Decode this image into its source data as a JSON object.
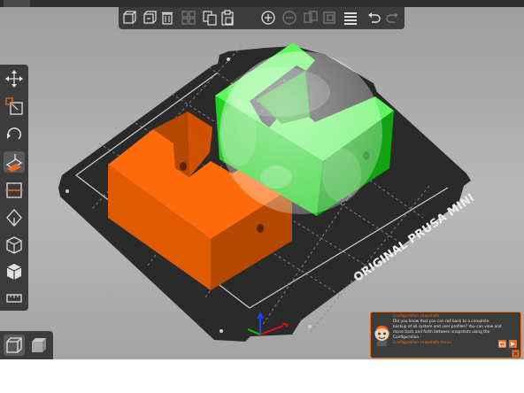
{
  "window": {
    "tabs": [
      {
        "id": "plater",
        "label": "",
        "active": true
      },
      {
        "id": "print-settings",
        "label": "",
        "active": false
      },
      {
        "id": "filament-settings",
        "label": "",
        "active": false
      },
      {
        "id": "printer-settings",
        "label": "",
        "active": false
      }
    ]
  },
  "toolbar": {
    "items": [
      {
        "id": "add",
        "icon": "add-icon",
        "enabled": true
      },
      {
        "id": "delete",
        "icon": "delete-icon",
        "enabled": true
      },
      {
        "id": "delete-all",
        "icon": "delete-all-icon",
        "enabled": true
      },
      {
        "id": "arrange",
        "icon": "arrange-icon",
        "enabled": false
      },
      {
        "id": "copy",
        "icon": "copy-icon",
        "enabled": true
      },
      {
        "id": "paste",
        "icon": "paste-icon",
        "enabled": true
      },
      {
        "id": "add-instance",
        "icon": "add-instance-icon",
        "enabled": true
      },
      {
        "id": "remove-instance",
        "icon": "remove-instance-icon",
        "enabled": false
      },
      {
        "id": "split-objects",
        "icon": "split-objects-icon",
        "enabled": false
      },
      {
        "id": "layer-editing",
        "icon": "layers-icon",
        "enabled": true
      },
      {
        "id": "undo",
        "icon": "undo-icon",
        "enabled": true
      },
      {
        "id": "redo",
        "icon": "redo-icon",
        "enabled": false
      }
    ]
  },
  "gizmos": {
    "items": [
      {
        "id": "move",
        "icon": "move-icon",
        "active": false
      },
      {
        "id": "scale",
        "icon": "scale-icon",
        "active": false
      },
      {
        "id": "rotate",
        "icon": "rotate-icon",
        "active": false
      },
      {
        "id": "place-on-face",
        "icon": "place-on-face-icon",
        "active": true
      },
      {
        "id": "cut",
        "icon": "cut-icon",
        "active": false
      },
      {
        "id": "paint-supports",
        "icon": "paint-supports-icon",
        "active": false
      },
      {
        "id": "seam-painting",
        "icon": "seam-painting-icon",
        "active": false
      },
      {
        "id": "hollow",
        "icon": "hollow-icon",
        "active": false
      },
      {
        "id": "measure",
        "icon": "measure-icon",
        "active": false
      }
    ]
  },
  "view_modes": {
    "items": [
      {
        "id": "3d-view",
        "icon": "cube-wireframe-icon",
        "active": true
      },
      {
        "id": "preview",
        "icon": "cube-solid-icon",
        "active": false
      }
    ]
  },
  "scene": {
    "bed_label": "ORIGINAL PRUSA MINI",
    "colors": {
      "bed": "#2a2a2a",
      "grid": "#8a8a8a",
      "orange_object": "#e05a00",
      "green_object": "#22d022",
      "hover_sphere": "#ffffff",
      "axis_x": "#e01010",
      "axis_y": "#10c010",
      "axis_z": "#2040ff"
    }
  },
  "notification": {
    "title": "Configuration snapshots",
    "body": "Did you know that you can roll back to a complete backup of all system and user profiles? You can view and move back and forth between snapshots using the Configuration -",
    "link": "Configuration snapshots menu",
    "accent": "#ed6b21"
  }
}
